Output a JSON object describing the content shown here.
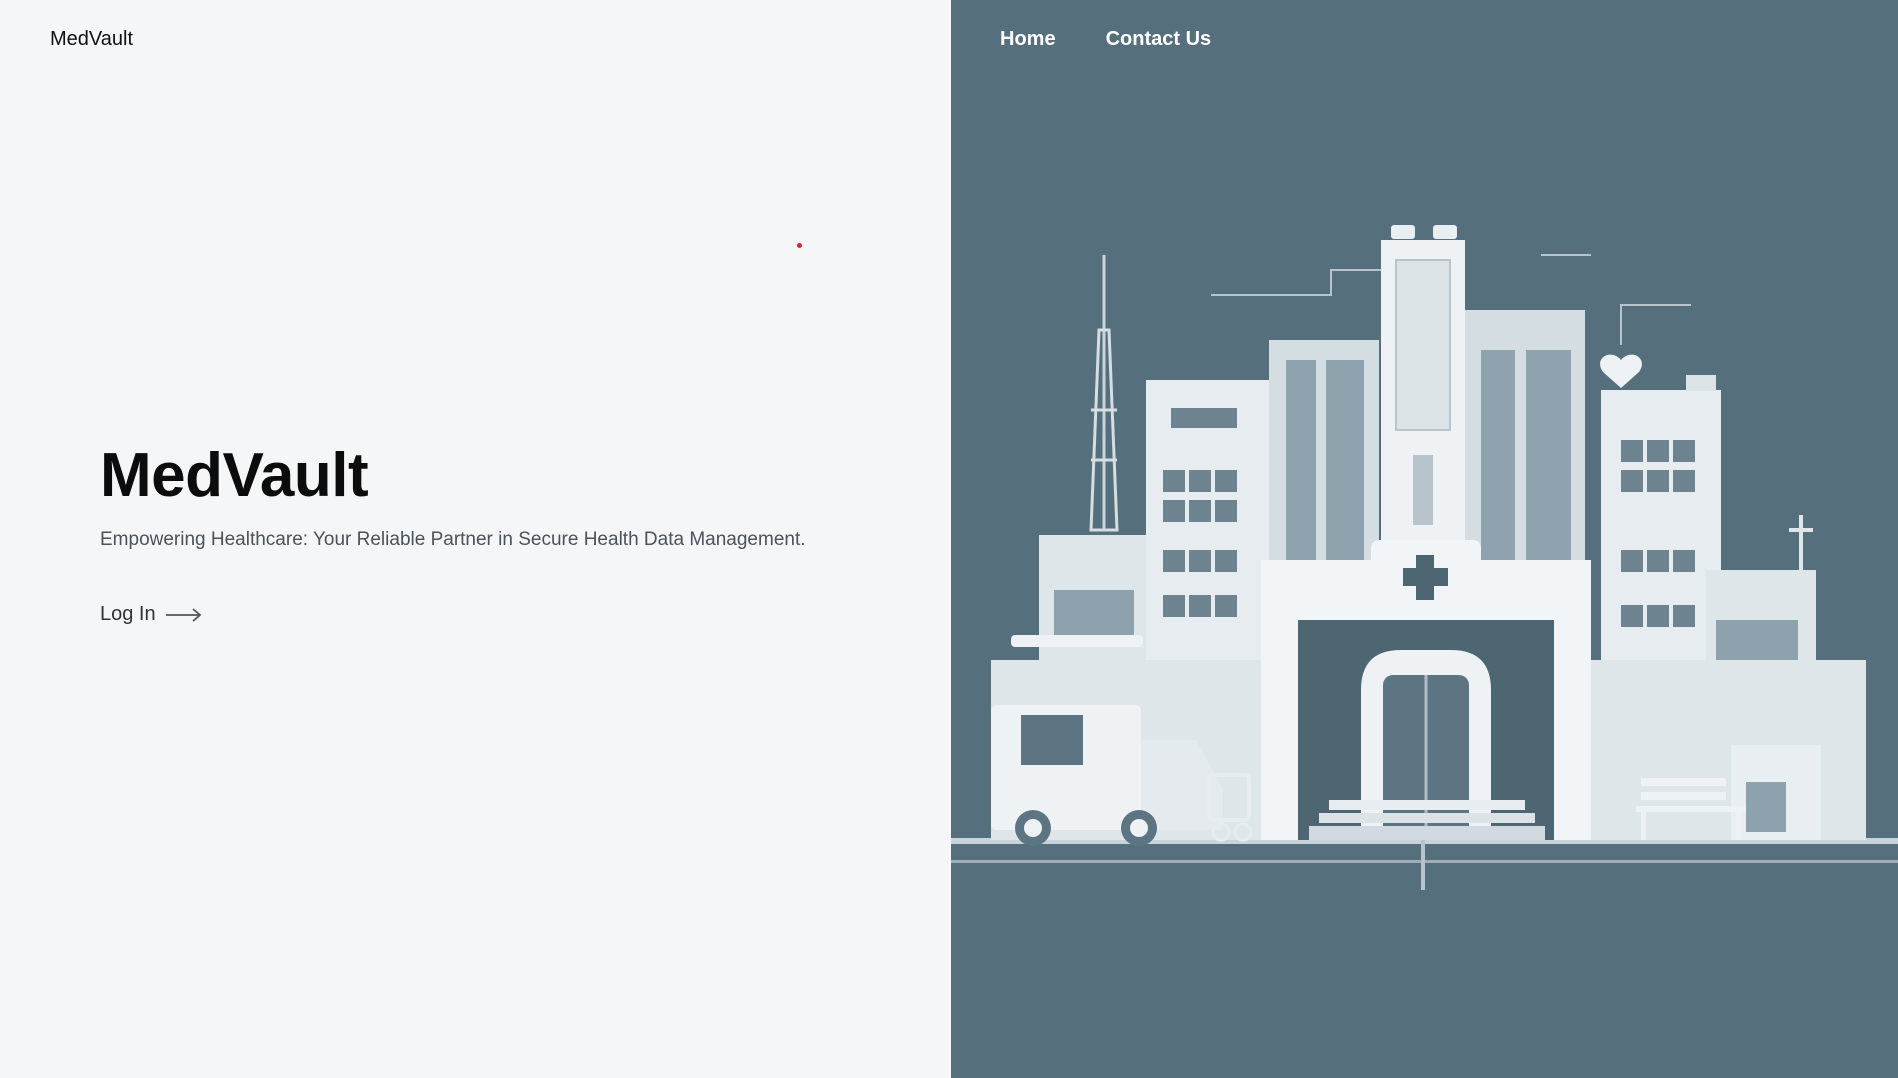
{
  "brand": {
    "name": "MedVault"
  },
  "nav": {
    "home": "Home",
    "contact": "Contact Us"
  },
  "hero": {
    "title": "MedVault",
    "subtitle": "Empowering Healthcare: Your Reliable Partner in Secure Health Data Management.",
    "login_label": "Log In"
  },
  "illustration": {
    "icon": "hospital-illustration"
  },
  "colors": {
    "left_bg": "#f5f6f8",
    "right_bg": "#556f7d",
    "accent_dot": "#d02a2a"
  }
}
